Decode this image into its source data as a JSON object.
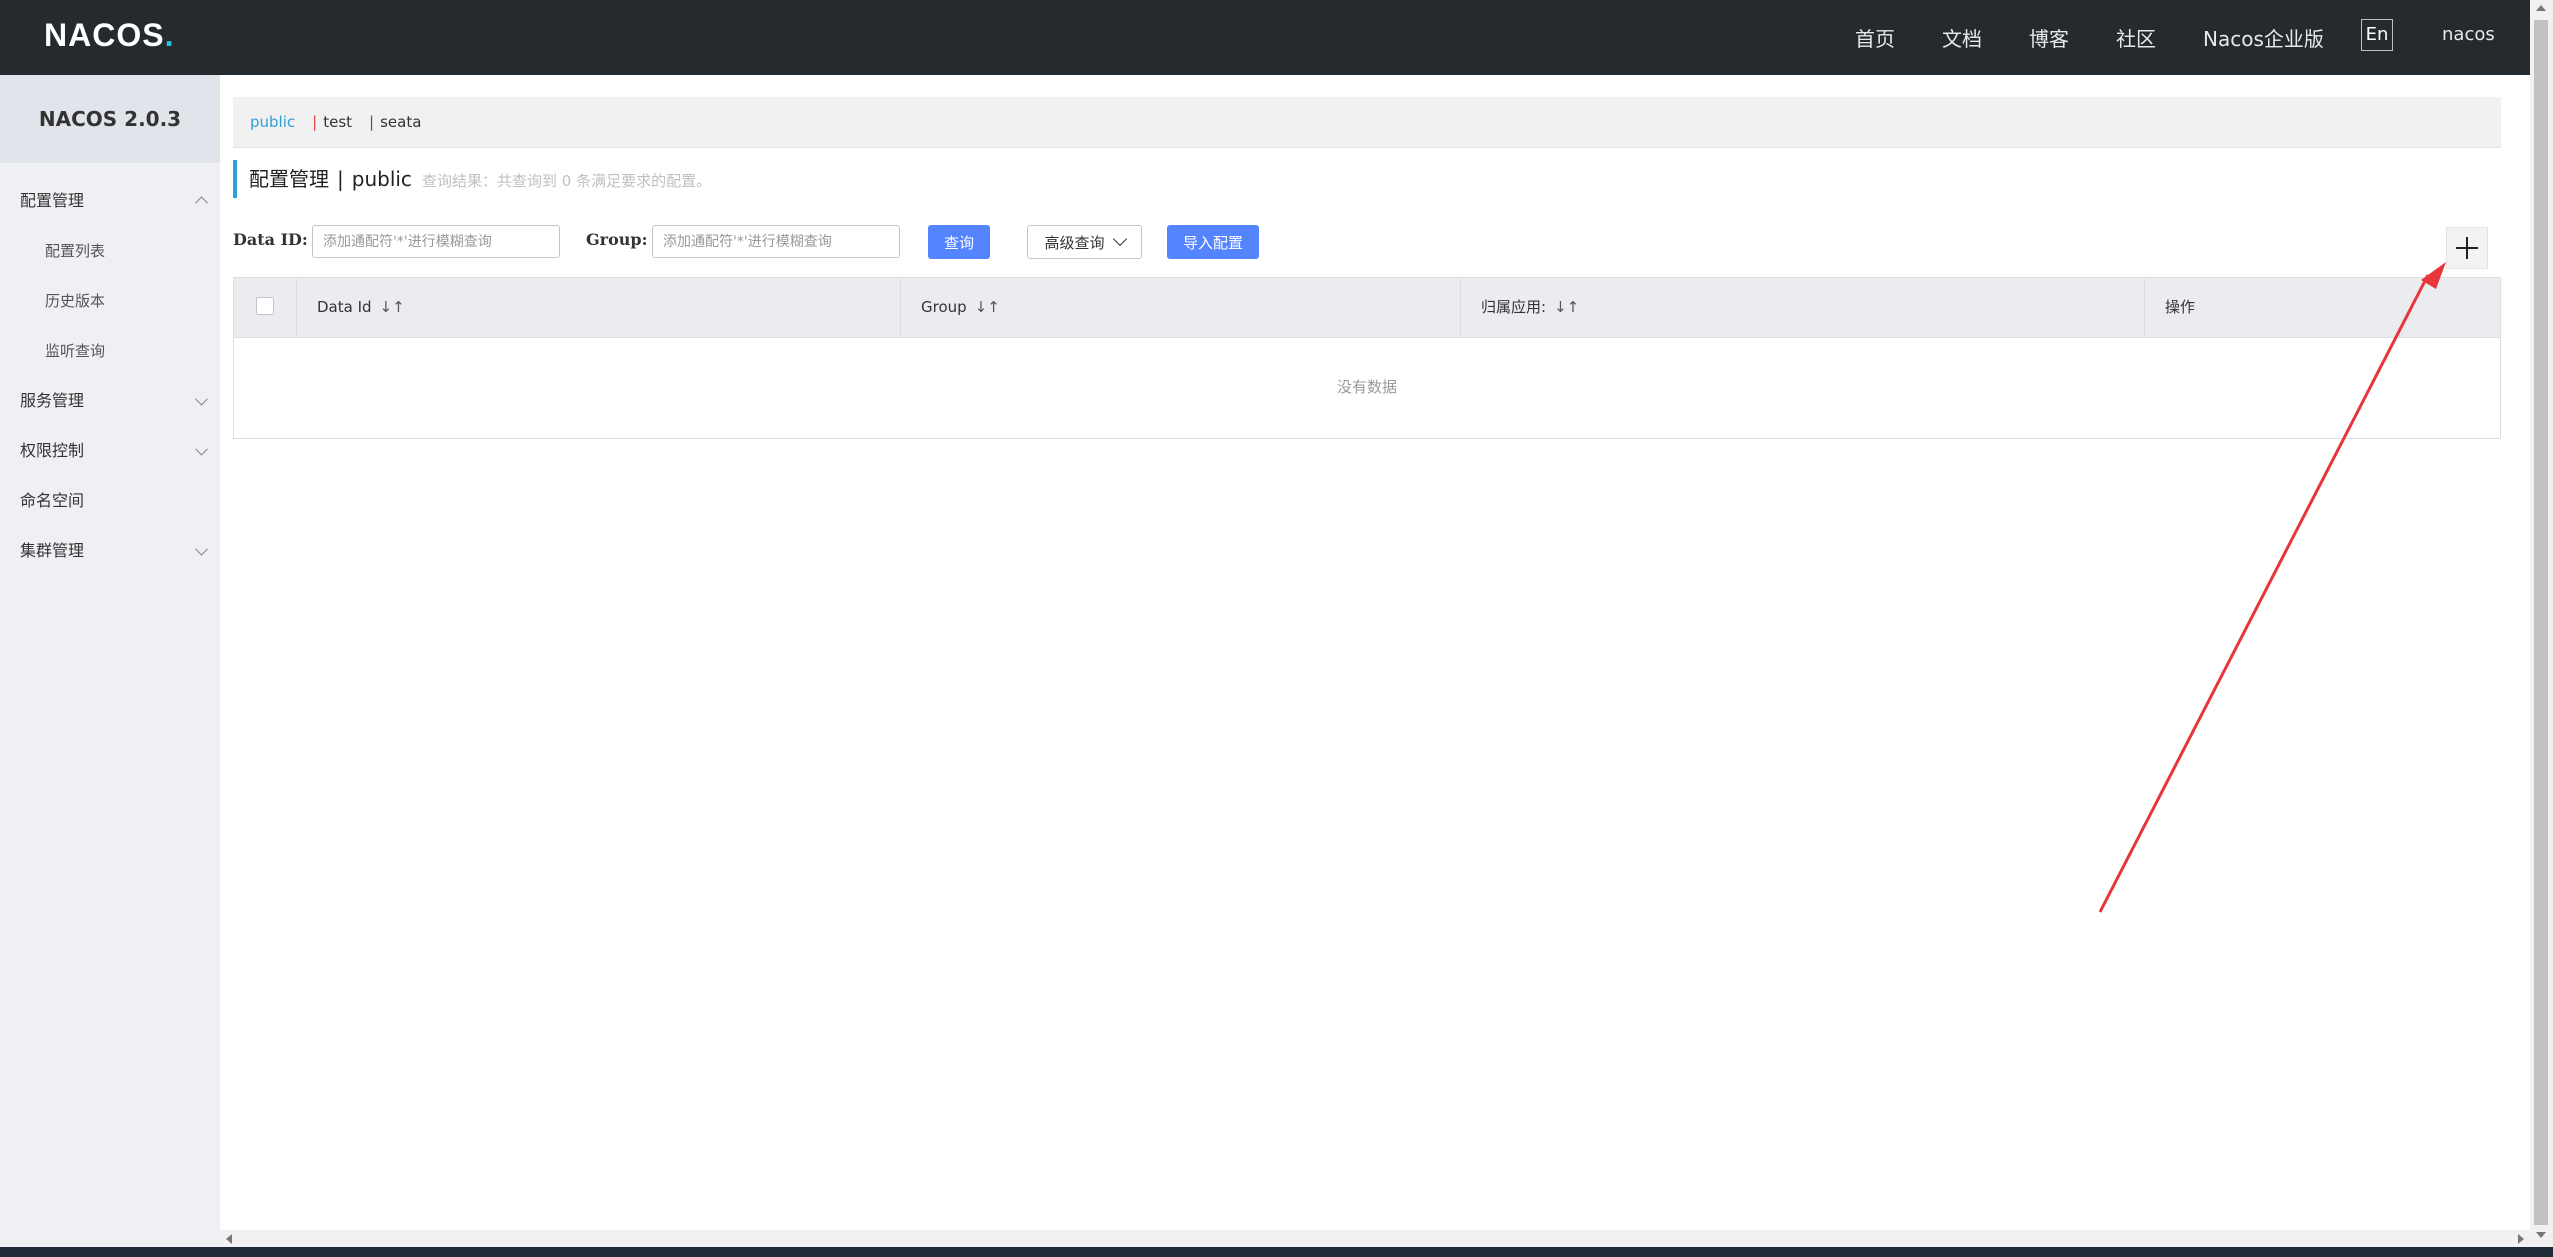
{
  "header": {
    "logo_main": "NACOS",
    "logo_dot": ".",
    "nav": [
      "首页",
      "文档",
      "博客",
      "社区",
      "Nacos企业版"
    ],
    "lang": "En",
    "user": "nacos"
  },
  "sidebar": {
    "title": "NACOS 2.0.3",
    "items": [
      {
        "label": "配置管理",
        "expanded": true,
        "children": [
          "配置列表",
          "历史版本",
          "监听查询"
        ]
      },
      {
        "label": "服务管理",
        "expanded": false
      },
      {
        "label": "权限控制",
        "expanded": false
      },
      {
        "label": "命名空间"
      },
      {
        "label": "集群管理",
        "expanded": false
      }
    ]
  },
  "namespaces": {
    "active": "public",
    "sep": "|",
    "others": [
      "test",
      "seata"
    ]
  },
  "page": {
    "title": "配置管理",
    "title_sep": "|",
    "namespace": "public",
    "query_hint": "查询结果：共查询到 0 条满足要求的配置。"
  },
  "filters": {
    "data_id_label": "Data ID:",
    "data_id_placeholder": "添加通配符'*'进行模糊查询",
    "group_label": "Group:",
    "group_placeholder": "添加通配符'*'进行模糊查询",
    "query_button": "查询",
    "advanced_button": "高级查询",
    "import_button": "导入配置",
    "add_button": "+"
  },
  "table": {
    "columns": [
      "Data Id",
      "Group",
      "归属应用:",
      "操作"
    ],
    "sort_glyph": "↓↑",
    "empty_text": "没有数据"
  },
  "colors": {
    "header_bg": "#252a2f",
    "accent": "#2ea0d8",
    "primary_button": "#5584ff",
    "annotation_arrow": "#e8343a"
  }
}
